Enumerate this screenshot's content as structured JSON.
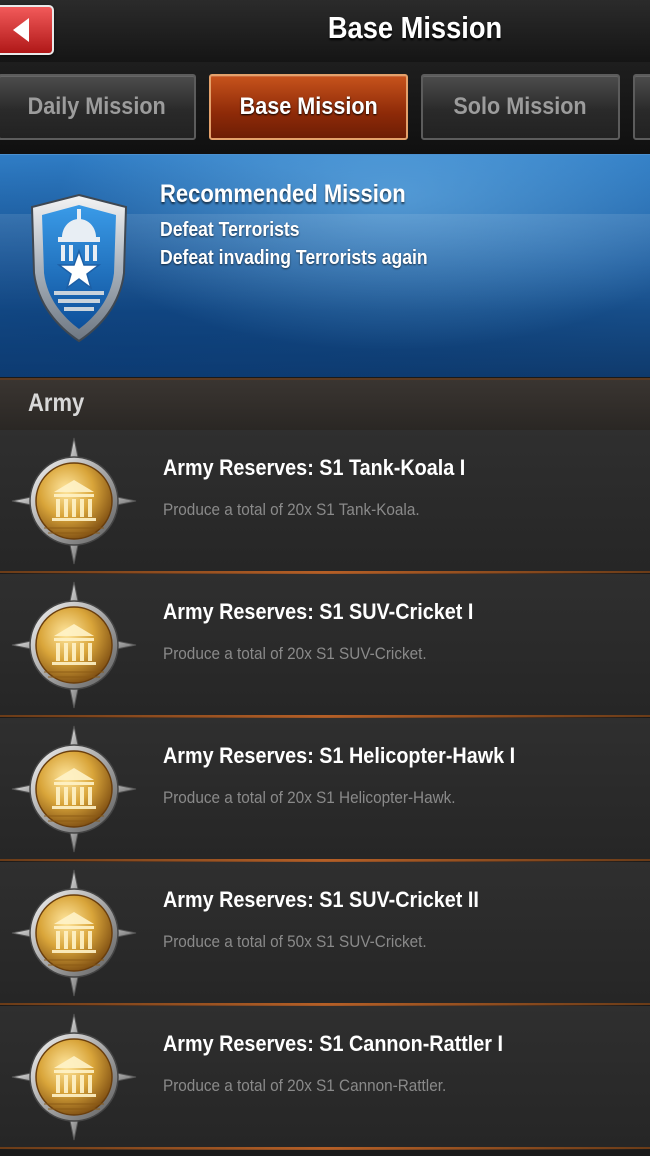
{
  "header": {
    "title": "Base Mission"
  },
  "tabs": [
    {
      "label": "Daily Mission",
      "active": false
    },
    {
      "label": "Base Mission",
      "active": true
    },
    {
      "label": "Solo Mission",
      "active": false
    },
    {
      "label": "",
      "active": false
    }
  ],
  "recommended": {
    "heading": "Recommended Mission",
    "line1": "Defeat Terrorists",
    "line2": "Defeat invading Terrorists again",
    "icon": "capitol-shield-icon"
  },
  "section": {
    "title": "Army"
  },
  "missions": [
    {
      "title": "Army Reserves: S1 Tank-Koala I",
      "desc": "Produce a total of 20x S1 Tank-Koala.",
      "icon": "barracks-medal-icon"
    },
    {
      "title": "Army Reserves: S1 SUV-Cricket I",
      "desc": "Produce a total of 20x S1 SUV-Cricket.",
      "icon": "barracks-medal-icon"
    },
    {
      "title": "Army Reserves: S1 Helicopter-Hawk I",
      "desc": "Produce a total of 20x S1 Helicopter-Hawk.",
      "icon": "barracks-medal-icon"
    },
    {
      "title": "Army Reserves: S1 SUV-Cricket II",
      "desc": "Produce a total of 50x S1 SUV-Cricket.",
      "icon": "barracks-medal-icon"
    },
    {
      "title": "Army Reserves: S1 Cannon-Rattler I",
      "desc": "Produce a total of 20x S1 Cannon-Rattler.",
      "icon": "barracks-medal-icon"
    }
  ],
  "colors": {
    "accent": "#b8431a",
    "banner": "#1f5f9f",
    "gold": "#d9a53a"
  }
}
